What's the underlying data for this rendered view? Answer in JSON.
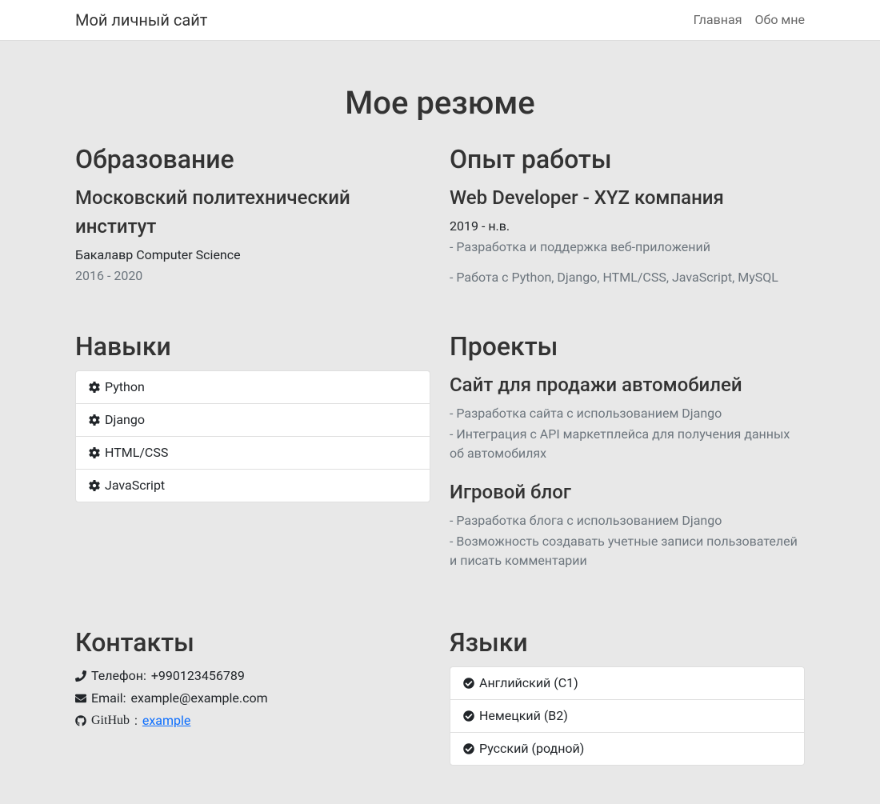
{
  "navbar": {
    "brand": "Мой личный сайт",
    "links": {
      "home": "Главная",
      "about": "Обо мне"
    }
  },
  "title": "Мое резюме",
  "education": {
    "heading": "Образование",
    "school": "Московский политехнический институт",
    "degree": "Бакалавр Computer Science",
    "years": "2016 - 2020"
  },
  "experience": {
    "heading": "Опыт работы",
    "position": "Web Developer - XYZ компания",
    "period": "2019 - н.в.",
    "bullet1": "- Разработка и поддержка веб-приложений",
    "bullet2": "- Работа с Python, Django, HTML/CSS, JavaScript, MySQL"
  },
  "skills": {
    "heading": "Навыки",
    "items": [
      "Python",
      "Django",
      "HTML/CSS",
      "JavaScript"
    ]
  },
  "projects": {
    "heading": "Проекты",
    "list": [
      {
        "title": "Сайт для продажи автомобилей",
        "bullets": [
          "- Разработка сайта с использованием Django",
          "- Интеграция с API маркетплейса для получения данных об автомобилях"
        ]
      },
      {
        "title": "Игровой блог",
        "bullets": [
          "- Разработка блога с использованием Django",
          "- Возможность создавать учетные записи пользователей и писать комментарии"
        ]
      }
    ]
  },
  "contacts": {
    "heading": "Контакты",
    "phone_label": "Телефон: ",
    "phone": "+990123456789",
    "email_label": "Email: ",
    "email": "example@example.com",
    "github_label": "GitHub",
    "github_user": "example"
  },
  "languages": {
    "heading": "Языки",
    "items": [
      "Английский (C1)",
      "Немецкий (B2)",
      "Русский (родной)"
    ]
  }
}
